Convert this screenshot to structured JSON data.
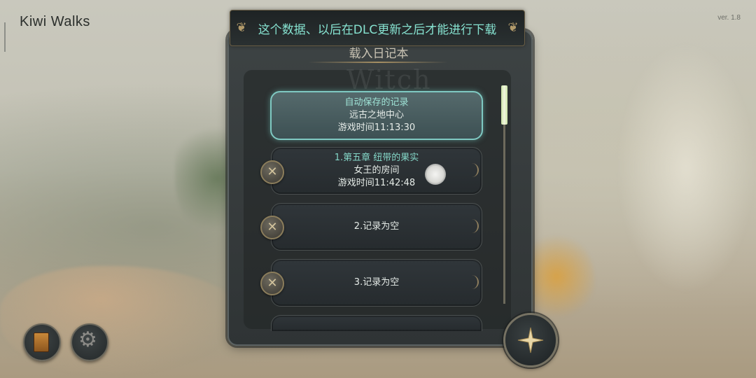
{
  "brand": "Kiwi Walks",
  "version": "ver. 1.8",
  "notice": "这个数据、以后在DLC更新之后才能进行下载",
  "title": "载入日记本",
  "watermark": "Witch",
  "slots": [
    {
      "line1": "自动保存的记录",
      "line2": "远古之地中心",
      "line3": "游戏时间11:13:30",
      "selected": true
    },
    {
      "line1": "1.第五章 纽带的果实",
      "line2": "女王的房间",
      "line3": "游戏时间11:42:48"
    },
    {
      "line1": "",
      "line2": "2.记录为空",
      "line3": ""
    },
    {
      "line1": "",
      "line2": "3.记录为空",
      "line3": ""
    }
  ],
  "icons": {
    "delete": "x-icon",
    "diary": "book-icon",
    "settings": "gears-icon",
    "confirm": "compass-star-icon"
  },
  "colors": {
    "notice_text": "#86e2d0",
    "selected_border": "#7fc9c2",
    "gold_accent": "#a58e63"
  }
}
